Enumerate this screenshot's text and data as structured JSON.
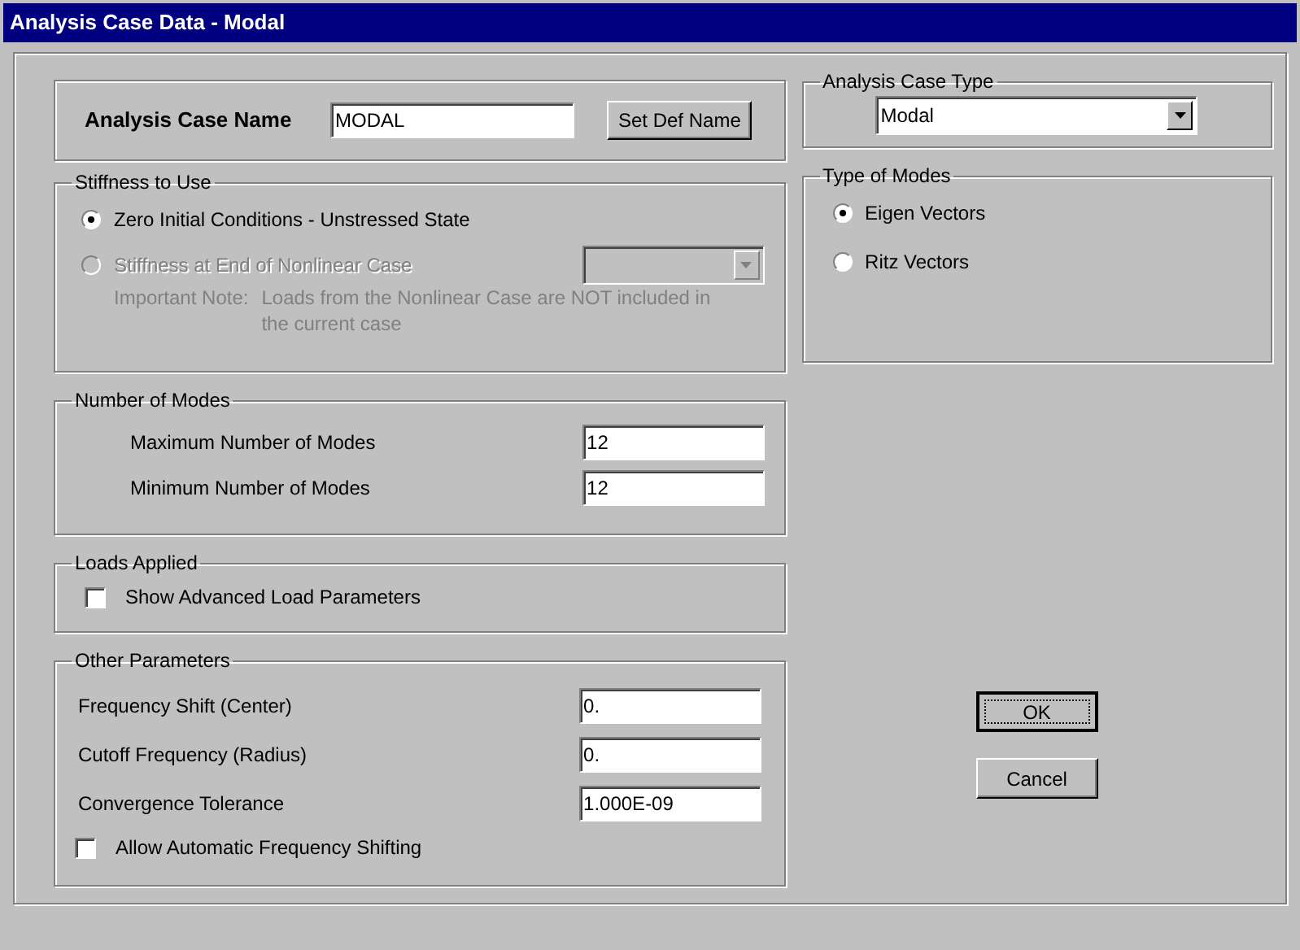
{
  "window": {
    "title": "Analysis Case Data - Modal"
  },
  "case_name": {
    "label": "Analysis Case Name",
    "value": "MODAL",
    "button": "Set Def Name"
  },
  "stiffness": {
    "title": "Stiffness to Use",
    "options": [
      {
        "label": "Zero Initial Conditions - Unstressed State",
        "selected": true,
        "disabled": false
      },
      {
        "label": "Stiffness at End of Nonlinear Case",
        "selected": false,
        "disabled": true
      }
    ],
    "note_label": "Important Note:",
    "note": "Loads from the Nonlinear Case are NOT included in the current case"
  },
  "modes": {
    "title": "Number of Modes",
    "fields": [
      {
        "label": "Maximum Number of Modes",
        "value": "12"
      },
      {
        "label": "Minimum Number of Modes",
        "value": "12"
      }
    ]
  },
  "loads": {
    "title": "Loads Applied",
    "checkbox": {
      "label": "Show Advanced Load Parameters",
      "checked": false
    }
  },
  "other": {
    "title": "Other Parameters",
    "fields": [
      {
        "label": "Frequency Shift (Center)",
        "value": "0."
      },
      {
        "label": "Cutoff Frequency (Radius)",
        "value": "0."
      },
      {
        "label": "Convergence Tolerance",
        "value": "1.000E-09"
      }
    ],
    "checkbox": {
      "label": "Allow Automatic Frequency Shifting",
      "checked": false
    }
  },
  "case_type": {
    "title": "Analysis Case Type",
    "value": "Modal"
  },
  "type_of_modes": {
    "title": "Type of Modes",
    "options": [
      {
        "label": "Eigen Vectors",
        "selected": true,
        "disabled": false
      },
      {
        "label": "Ritz Vectors",
        "selected": false,
        "disabled": false
      }
    ]
  },
  "buttons": [
    {
      "label": "OK",
      "default": true
    },
    {
      "label": "Cancel",
      "default": false
    }
  ]
}
